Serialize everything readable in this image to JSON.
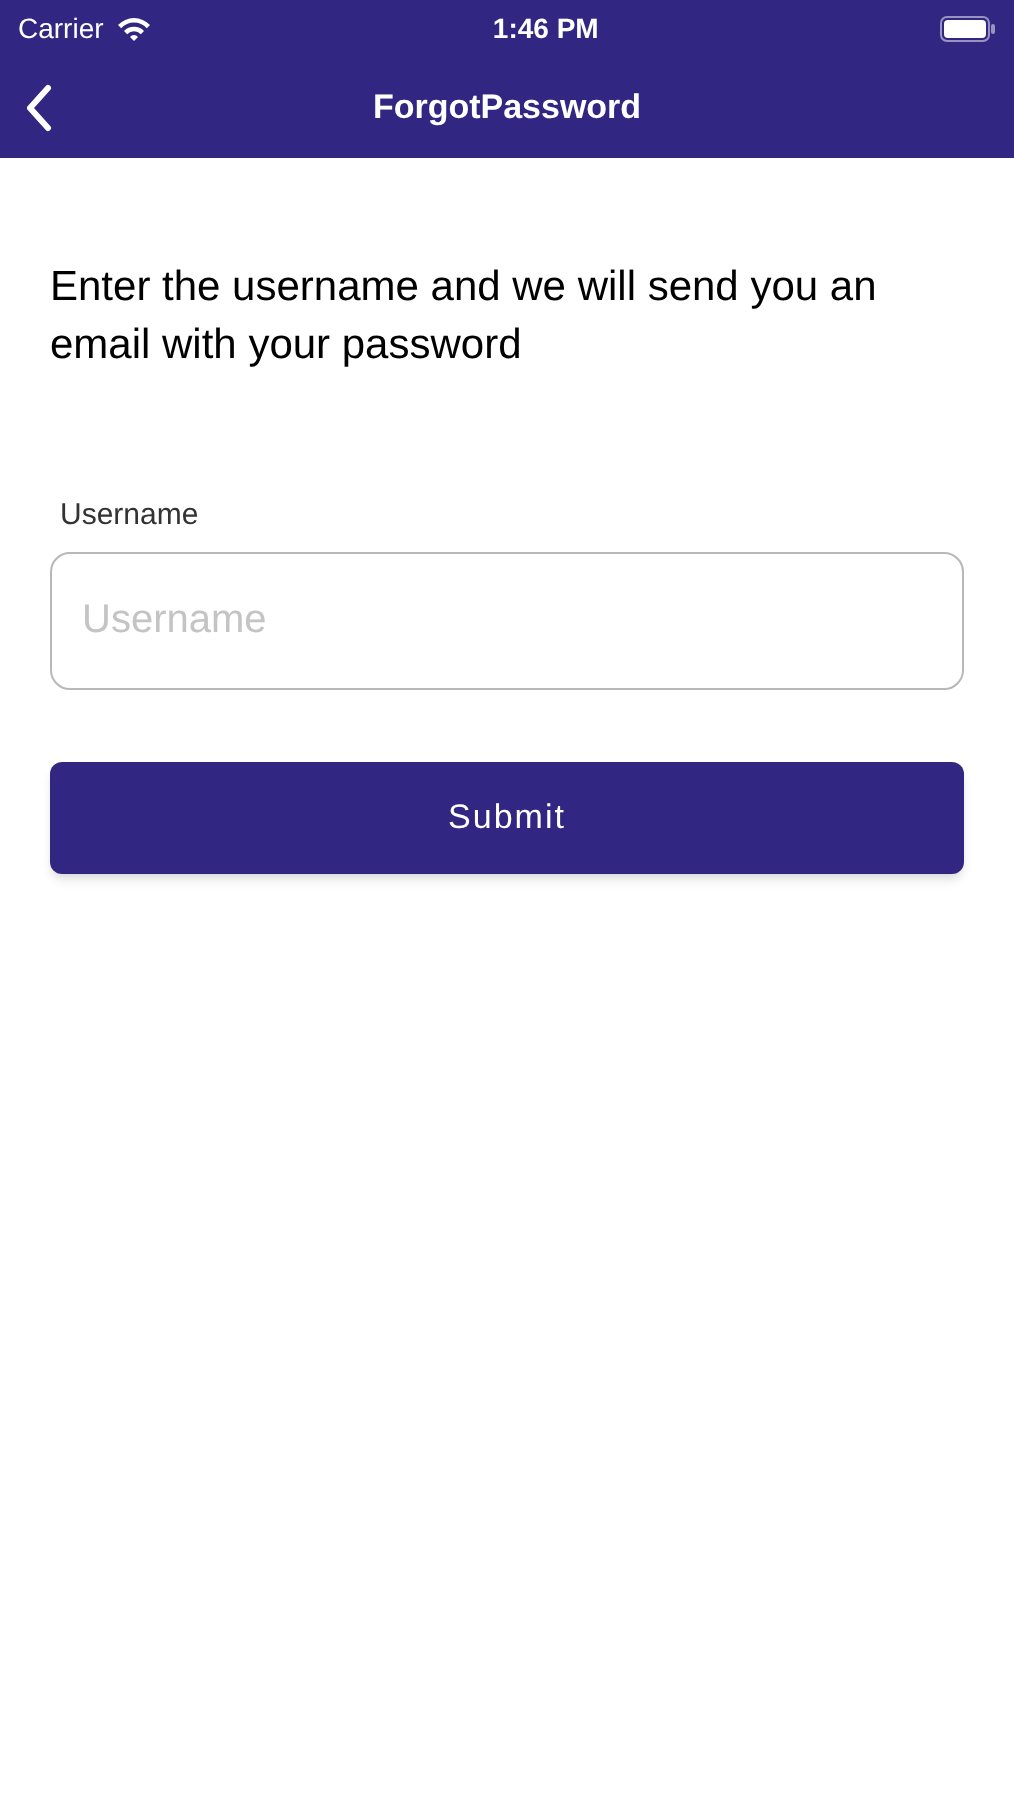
{
  "status_bar": {
    "carrier": "Carrier",
    "time": "1:46 PM"
  },
  "nav_bar": {
    "title": "ForgotPassword"
  },
  "instructions": "Enter the username and we will send you an email with your password",
  "username_field": {
    "label": "Username",
    "placeholder": "Username"
  },
  "submit_button": {
    "label": "Submit"
  }
}
